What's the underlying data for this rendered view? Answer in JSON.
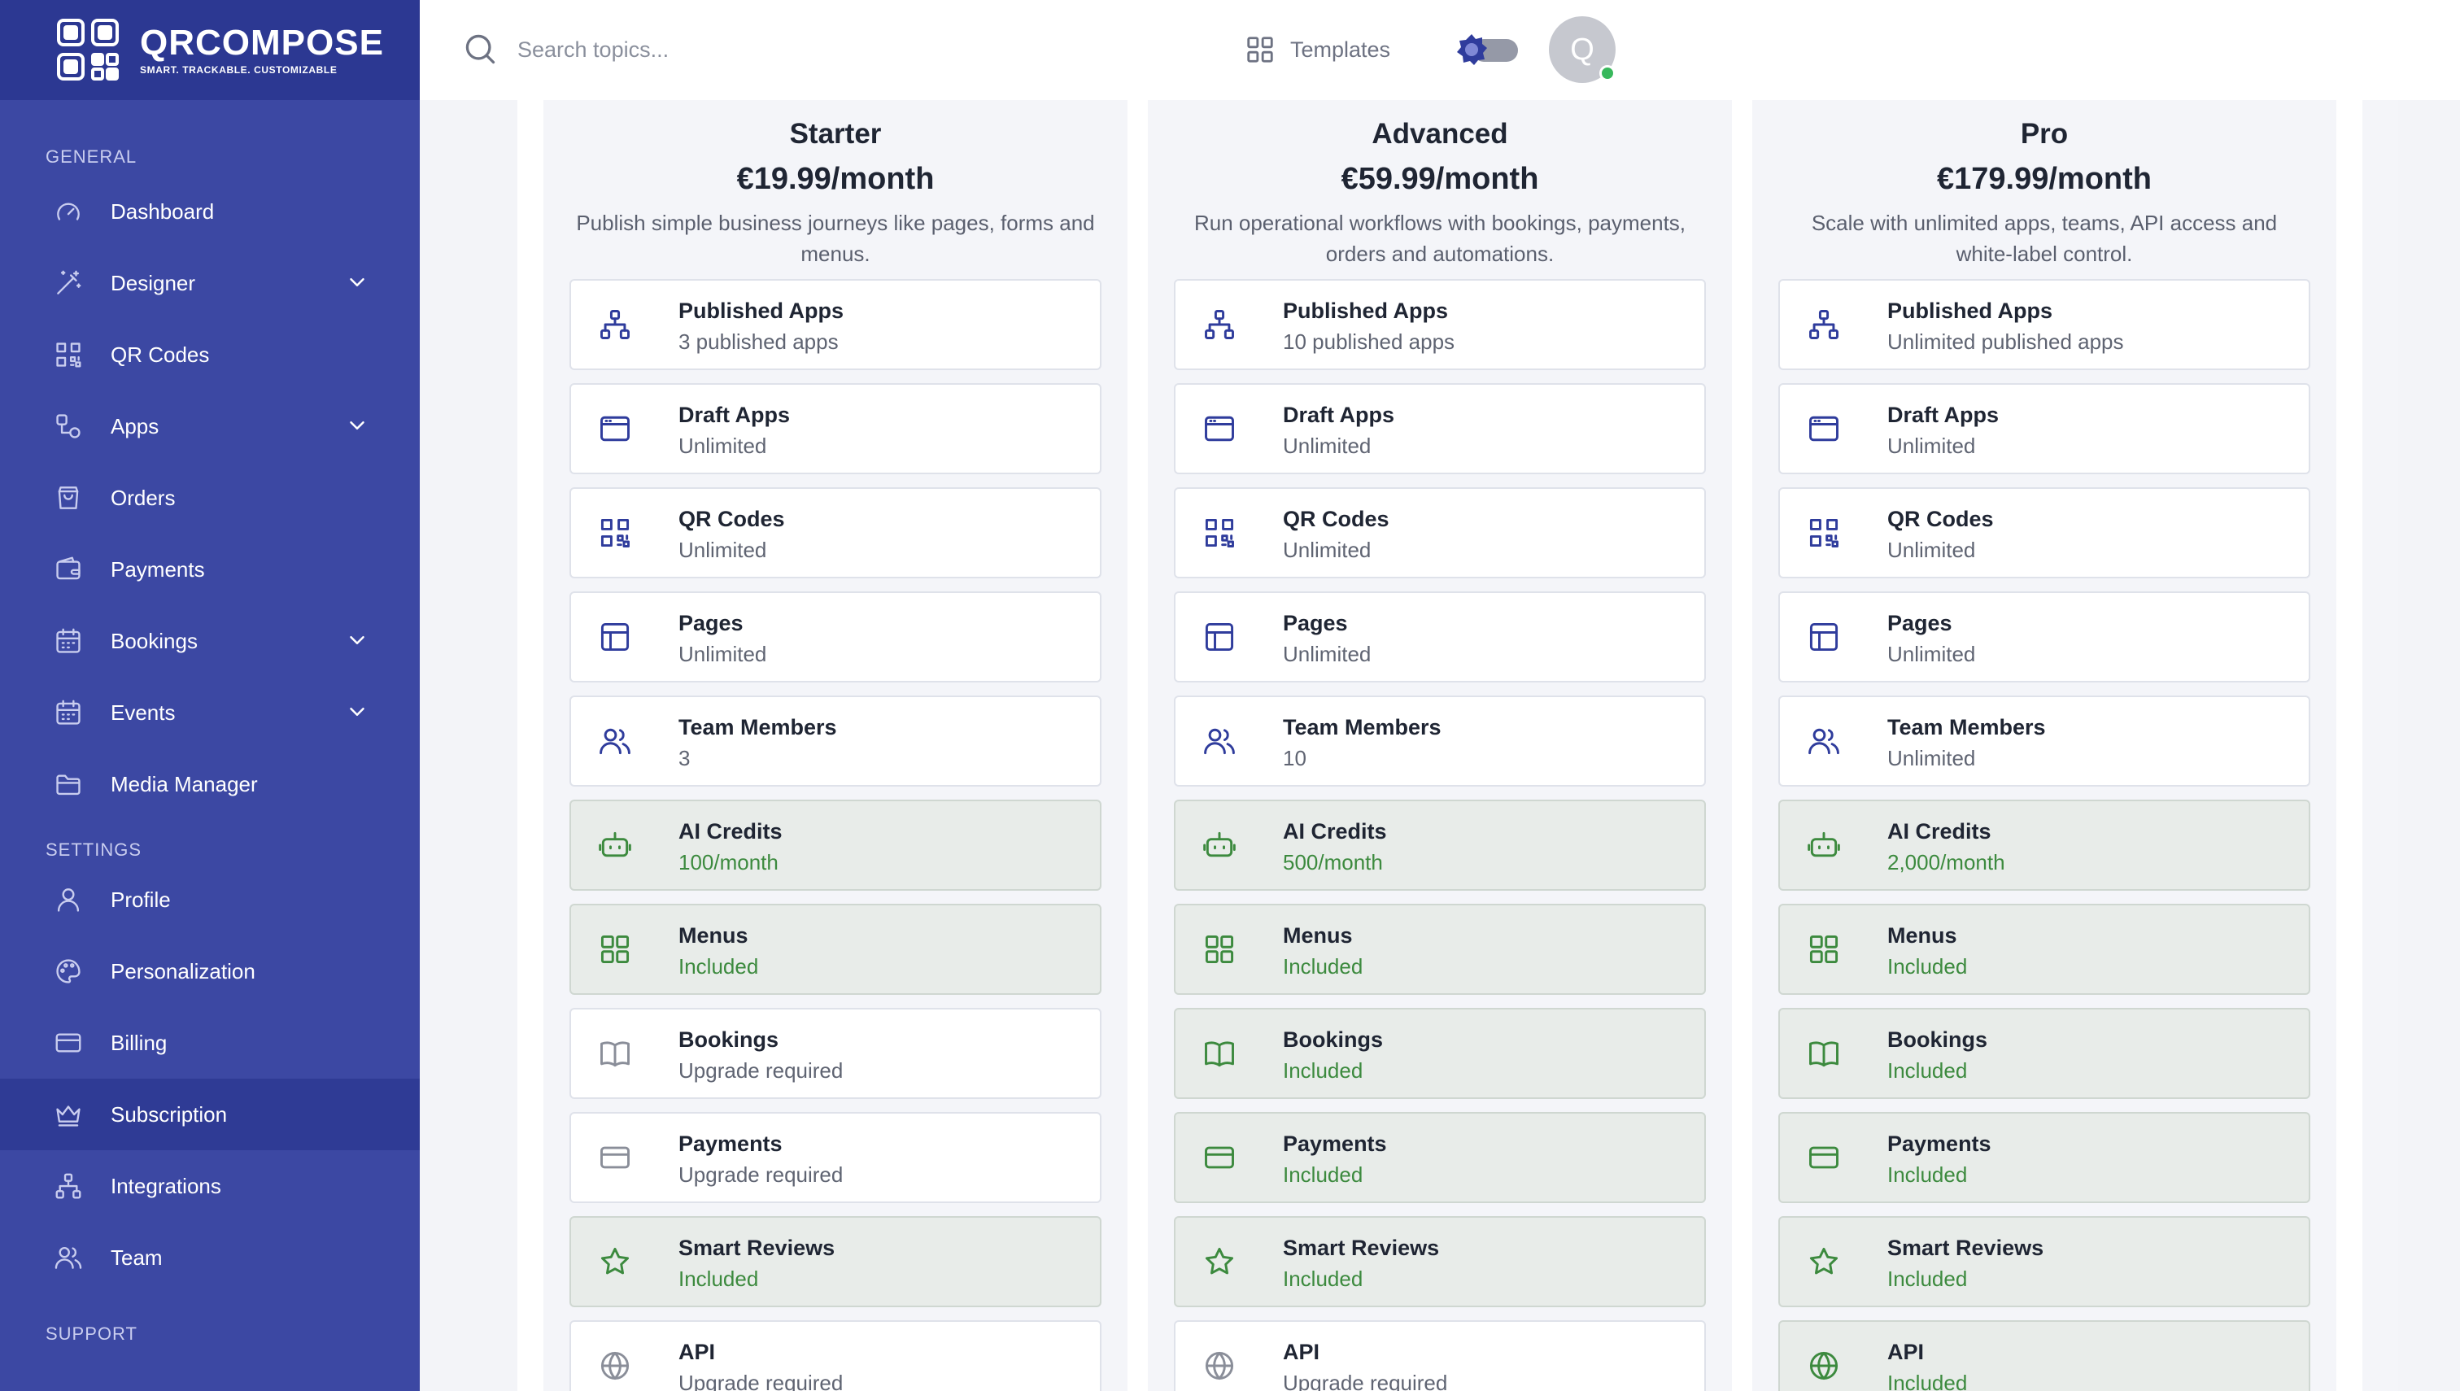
{
  "brand": {
    "name": "QRCOMPOSE",
    "tagline": "SMART. TRACKABLE. CUSTOMIZABLE"
  },
  "sidebar": {
    "general_label": "GENERAL",
    "general": [
      {
        "label": "Dashboard",
        "icon": "gauge-icon"
      },
      {
        "label": "Designer",
        "icon": "magic-wand-icon",
        "expandable": true
      },
      {
        "label": "QR Codes",
        "icon": "qr-code-icon"
      },
      {
        "label": "Apps",
        "icon": "apps-icon",
        "expandable": true
      },
      {
        "label": "Orders",
        "icon": "shopping-bag-icon"
      },
      {
        "label": "Payments",
        "icon": "wallet-icon"
      },
      {
        "label": "Bookings",
        "icon": "calendar-icon",
        "expandable": true
      },
      {
        "label": "Events",
        "icon": "calendar-icon",
        "expandable": true
      },
      {
        "label": "Media Manager",
        "icon": "folder-icon"
      }
    ],
    "settings_label": "SETTINGS",
    "settings": [
      {
        "label": "Profile",
        "icon": "user-icon"
      },
      {
        "label": "Personalization",
        "icon": "palette-icon"
      },
      {
        "label": "Billing",
        "icon": "credit-card-icon"
      },
      {
        "label": "Subscription",
        "icon": "crown-icon",
        "active": true
      },
      {
        "label": "Integrations",
        "icon": "sitemap-icon"
      },
      {
        "label": "Team",
        "icon": "users-icon"
      }
    ],
    "support_label": "SUPPORT"
  },
  "topbar": {
    "search_placeholder": "Search topics...",
    "templates_label": "Templates",
    "avatar_initial": "Q"
  },
  "colors": {
    "sidebar": "#3c48a3",
    "brand_bar": "#2c3892",
    "included_text": "#3c8a3e",
    "accent_icon": "#2f3c9c"
  },
  "plans": [
    {
      "name": "Starter",
      "price": "€19.99/month",
      "description": "Publish simple business journeys like pages, forms and menus.",
      "features": [
        {
          "title": "Published Apps",
          "value": "3 published apps",
          "icon": "sitemap-icon",
          "included": false
        },
        {
          "title": "Draft Apps",
          "value": "Unlimited",
          "icon": "browser-window-icon",
          "included": false
        },
        {
          "title": "QR Codes",
          "value": "Unlimited",
          "icon": "qr-code-icon",
          "included": false
        },
        {
          "title": "Pages",
          "value": "Unlimited",
          "icon": "layout-icon",
          "included": false
        },
        {
          "title": "Team Members",
          "value": "3",
          "icon": "users-icon",
          "included": false
        },
        {
          "title": "AI Credits",
          "value": "100/month",
          "icon": "robot-icon",
          "included": true
        },
        {
          "title": "Menus",
          "value": "Included",
          "icon": "grid-icon",
          "included": true
        },
        {
          "title": "Bookings",
          "value": "Upgrade required",
          "icon": "book-icon",
          "included": false
        },
        {
          "title": "Payments",
          "value": "Upgrade required",
          "icon": "credit-card-icon",
          "included": false
        },
        {
          "title": "Smart Reviews",
          "value": "Included",
          "icon": "star-icon",
          "included": true
        },
        {
          "title": "API",
          "value": "Upgrade required",
          "icon": "globe-icon",
          "included": false
        }
      ]
    },
    {
      "name": "Advanced",
      "price": "€59.99/month",
      "description": "Run operational workflows with bookings, payments, orders and automations.",
      "features": [
        {
          "title": "Published Apps",
          "value": "10 published apps",
          "icon": "sitemap-icon",
          "included": false
        },
        {
          "title": "Draft Apps",
          "value": "Unlimited",
          "icon": "browser-window-icon",
          "included": false
        },
        {
          "title": "QR Codes",
          "value": "Unlimited",
          "icon": "qr-code-icon",
          "included": false
        },
        {
          "title": "Pages",
          "value": "Unlimited",
          "icon": "layout-icon",
          "included": false
        },
        {
          "title": "Team Members",
          "value": "10",
          "icon": "users-icon",
          "included": false
        },
        {
          "title": "AI Credits",
          "value": "500/month",
          "icon": "robot-icon",
          "included": true
        },
        {
          "title": "Menus",
          "value": "Included",
          "icon": "grid-icon",
          "included": true
        },
        {
          "title": "Bookings",
          "value": "Included",
          "icon": "book-icon",
          "included": true
        },
        {
          "title": "Payments",
          "value": "Included",
          "icon": "credit-card-icon",
          "included": true
        },
        {
          "title": "Smart Reviews",
          "value": "Included",
          "icon": "star-icon",
          "included": true
        },
        {
          "title": "API",
          "value": "Upgrade required",
          "icon": "globe-icon",
          "included": false
        }
      ]
    },
    {
      "name": "Pro",
      "price": "€179.99/month",
      "description": "Scale with unlimited apps, teams, API access and white-label control.",
      "features": [
        {
          "title": "Published Apps",
          "value": "Unlimited published apps",
          "icon": "sitemap-icon",
          "included": false
        },
        {
          "title": "Draft Apps",
          "value": "Unlimited",
          "icon": "browser-window-icon",
          "included": false
        },
        {
          "title": "QR Codes",
          "value": "Unlimited",
          "icon": "qr-code-icon",
          "included": false
        },
        {
          "title": "Pages",
          "value": "Unlimited",
          "icon": "layout-icon",
          "included": false
        },
        {
          "title": "Team Members",
          "value": "Unlimited",
          "icon": "users-icon",
          "included": false
        },
        {
          "title": "AI Credits",
          "value": "2,000/month",
          "icon": "robot-icon",
          "included": true
        },
        {
          "title": "Menus",
          "value": "Included",
          "icon": "grid-icon",
          "included": true
        },
        {
          "title": "Bookings",
          "value": "Included",
          "icon": "book-icon",
          "included": true
        },
        {
          "title": "Payments",
          "value": "Included",
          "icon": "credit-card-icon",
          "included": true
        },
        {
          "title": "Smart Reviews",
          "value": "Included",
          "icon": "star-icon",
          "included": true
        },
        {
          "title": "API",
          "value": "Included",
          "icon": "globe-icon",
          "included": true
        }
      ]
    }
  ]
}
